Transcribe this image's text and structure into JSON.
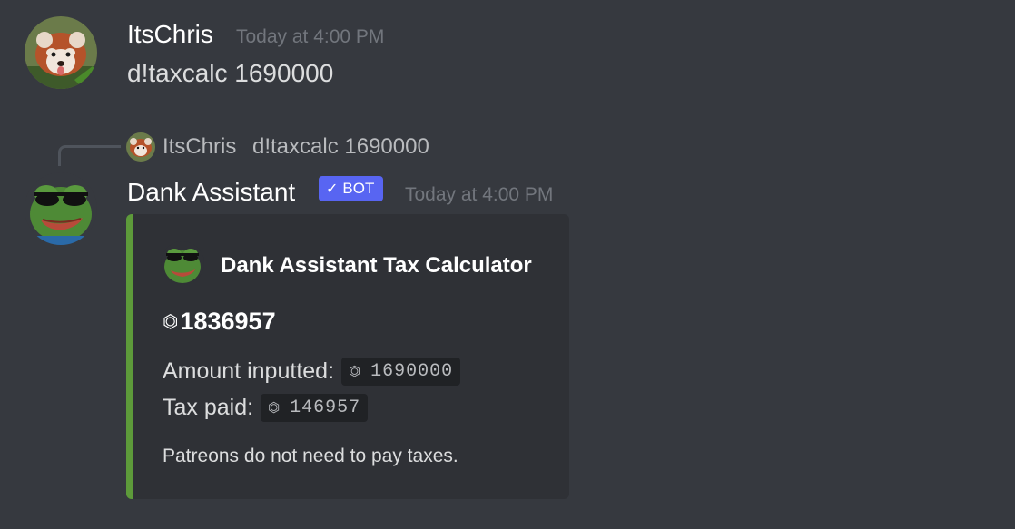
{
  "messages": {
    "user": {
      "username": "ItsChris",
      "timestamp": "Today at 4:00 PM",
      "content": "d!taxcalc 1690000"
    },
    "reply": {
      "username": "ItsChris",
      "content": "d!taxcalc 1690000"
    },
    "bot": {
      "username": "Dank Assistant",
      "badge": "BOT",
      "badge_check": "✓",
      "timestamp": "Today at 4:00 PM",
      "embed": {
        "author": "Dank Assistant Tax Calculator",
        "coin_symbol": "⏣",
        "title_value": "1836957",
        "amount_label": "Amount inputted:",
        "amount_value": "1690000",
        "tax_label": "Tax paid:",
        "tax_value": "146957",
        "footer": "Patreons do not need to pay taxes.",
        "accent_color": "#5d9a3a"
      }
    }
  },
  "colors": {
    "background": "#36393f",
    "embed_background": "#2f3136",
    "bot_badge": "#5865f2",
    "timestamp": "#72767d"
  },
  "icons": {
    "user_avatar": "red-panda-avatar",
    "bot_avatar": "pepe-sunglasses-avatar"
  }
}
